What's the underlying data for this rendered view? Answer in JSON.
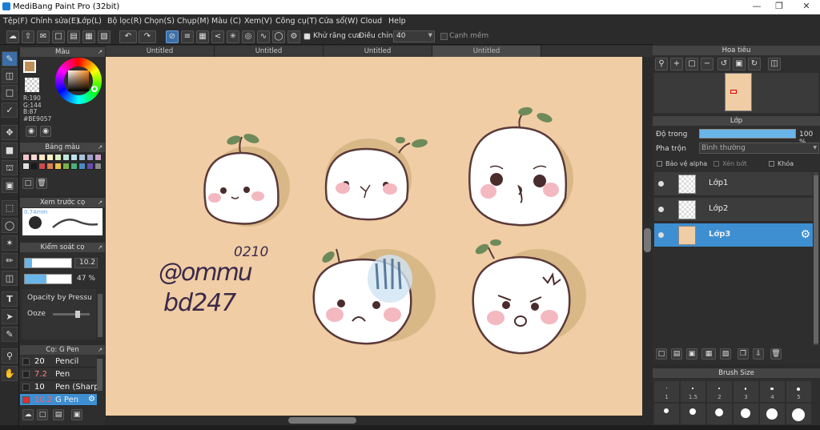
{
  "app": {
    "title": "MediBang Paint Pro (32bit)"
  },
  "menu": [
    "Tệp(F)",
    "Chỉnh sửa(E)",
    "Lớp(L)",
    "Bộ lọc(R)",
    "Chọn(S)",
    "Chụp(M)",
    "Màu (C)",
    "Xem(V)",
    "Công cụ(T)",
    "Cửa sổ(W)",
    "Cloud",
    "Help"
  ],
  "toolbar": {
    "antialias_label": "Khử răng cưa",
    "adjust_label": "Điều chỉnh",
    "adjust_value": "40",
    "smooth_label": "Cạnh mềm"
  },
  "tabs": [
    "Untitled",
    "Untitled",
    "Untitled",
    "Untitled"
  ],
  "color_panel": {
    "title": "Màu",
    "r": "R:190",
    "g": "G:144",
    "b": "B:87",
    "hex": "#BE9057",
    "fg": "#BE9057"
  },
  "palette": {
    "title": "Bảng màu",
    "colors": [
      "#f4c2c8",
      "#f7d7d0",
      "#ffe4c4",
      "#fff3c6",
      "#d9efc2",
      "#c1e5d9",
      "#bfe0ee",
      "#a8c4d9",
      "#9f9fc7",
      "#c8a2c8",
      "#e0e0e0",
      "#1a1a1a",
      "#cc4a4a",
      "#d9824a",
      "#e8c14a",
      "#7ab04a",
      "#4ab07a",
      "#4a8ac4",
      "#6a4ab0",
      "#8a8a8a"
    ]
  },
  "preview": {
    "title": "Xem trước cọ",
    "size": "0.74mm"
  },
  "brush_control": {
    "title": "Kiểm soát cọ",
    "size_value": "10.2",
    "opacity_value": "47 %",
    "size_fill": 0.15,
    "opacity_fill": 0.47,
    "opacity_by_pressure": "Opacity by Pressu",
    "ooze": "Ooze"
  },
  "brush_list": {
    "title": "Cọ: G Pen",
    "items": [
      {
        "size": "20",
        "name": "Pencil",
        "size_color": "#ffffff"
      },
      {
        "size": "7.2",
        "name": "Pen",
        "size_color": "#ff8080"
      },
      {
        "size": "10",
        "name": "Pen (Sharp)",
        "size_color": "#ffffff"
      },
      {
        "size": "10.2",
        "name": "G Pen",
        "size_color": "#ff6060"
      }
    ]
  },
  "navigator": {
    "title": "Hoa tiêu"
  },
  "layers_panel": {
    "title": "Lớp",
    "opacity_label": "Độ trong",
    "opacity_value": "100 %",
    "opacity_fill": 1.0,
    "blend_label": "Pha trộn",
    "blend_value": "Bình thường",
    "protect_alpha": "Bảo vệ alpha",
    "clipping": "Xén bớt",
    "lock": "Khóa",
    "layers": [
      "Lớp1",
      "Lớp2",
      "Lớp3"
    ]
  },
  "brush_size": {
    "title": "Brush Size",
    "labels": [
      "1",
      "1.5",
      "2",
      "3",
      "4",
      "5"
    ]
  },
  "canvas": {
    "text_top": "0210",
    "text_mid": "@ommu",
    "text_bot": "bd247",
    "bg": "#f0cda4"
  }
}
